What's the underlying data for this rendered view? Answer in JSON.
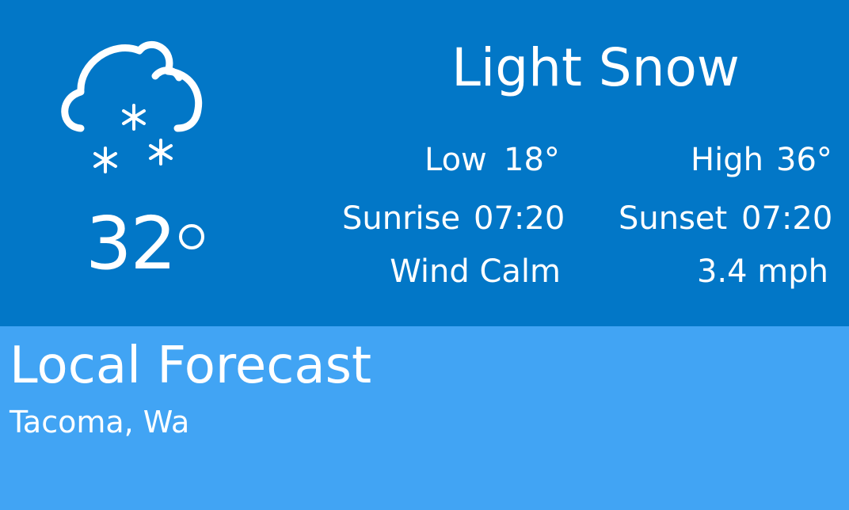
{
  "current": {
    "condition": "Light Snow",
    "icon": "snow-cloud-icon",
    "temperature": "32"
  },
  "details": {
    "low_label": "Low",
    "low_value": "18°",
    "high_label": "High",
    "high_value": "36°",
    "sunrise_label": "Sunrise",
    "sunrise_value": "07:20",
    "sunset_label": "Sunset",
    "sunset_value": "07:20",
    "wind_label": "Wind Calm",
    "wind_speed": "3.4 mph"
  },
  "forecast": {
    "title": "Local Forecast",
    "location": "Tacoma, Wa"
  },
  "colors": {
    "header_bg": "#0277c7",
    "panel_bg": "#41a4f4",
    "text": "#ffffff"
  }
}
